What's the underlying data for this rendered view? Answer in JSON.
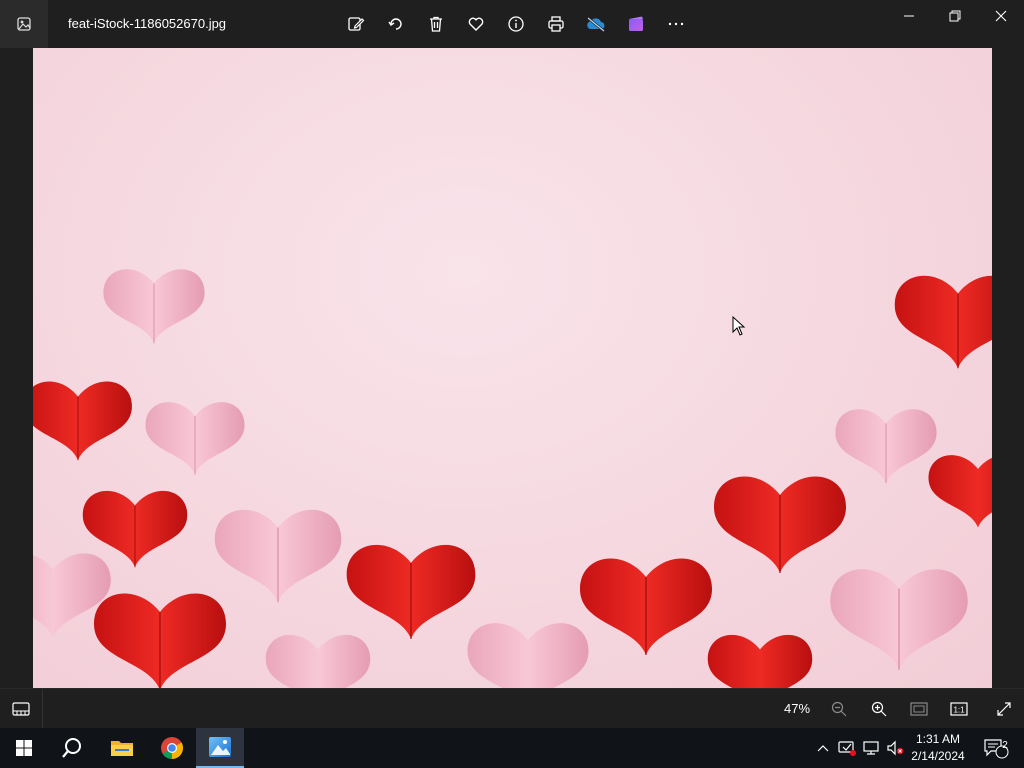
{
  "window": {
    "filename": "feat-iStock-1186052670.jpg",
    "toolbar_icons": [
      "edit-image-icon",
      "rotate-icon",
      "delete-icon",
      "favorite-icon",
      "info-icon",
      "print-icon",
      "onedrive-icon",
      "video-editor-icon",
      "more-icon"
    ],
    "controls": [
      "minimize-icon",
      "restore-icon",
      "close-icon"
    ]
  },
  "statusbar": {
    "zoom": "47%",
    "icons": [
      "filmstrip-icon",
      "zoom-out-icon",
      "zoom-in-icon",
      "fit-to-window-icon",
      "actual-size-icon",
      "full-screen-icon"
    ]
  },
  "taskbar": {
    "apps": [
      "windows-start-icon",
      "search-icon",
      "file-explorer-icon",
      "chrome-icon",
      "photos-icon"
    ],
    "tray_icons": [
      "show-hidden-icons-icon",
      "defender-icon",
      "network-icon",
      "volume-muted-icon"
    ],
    "time": "1:31 AM",
    "date": "2/14/2024",
    "notification_count": "2"
  },
  "colors": {
    "accent": "#76b9ed",
    "heart_red": "#e01b1b",
    "heart_pink": "#f3b6c8",
    "photo_bg": "#f5d6de"
  }
}
